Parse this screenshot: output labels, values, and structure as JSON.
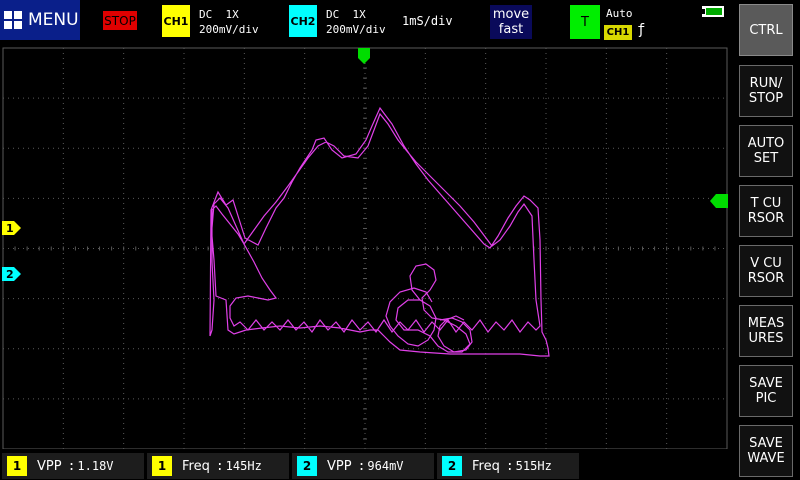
{
  "topbar": {
    "menu_label": "MENU",
    "stop_label": "STOP",
    "ch1": {
      "badge": "CH1",
      "coupling": "DC  1X",
      "scale": "200mV/div",
      "color": "#ffff00"
    },
    "ch2": {
      "badge": "CH2",
      "coupling": "DC  1X",
      "scale": "200mV/div",
      "color": "#00ffff"
    },
    "timebase": "1mS/div",
    "move_line1": "move",
    "move_line2": "fast",
    "trigger": {
      "badge": "T",
      "mode": "Auto",
      "source": "CH1",
      "edge": "ƒ",
      "color": "#00ee00"
    }
  },
  "markers": {
    "ch1_label": "1",
    "ch2_label": "2"
  },
  "side_buttons": [
    {
      "label": "CTRL",
      "active": true
    },
    {
      "label": "RUN/\nSTOP",
      "active": false
    },
    {
      "label": "AUTO\nSET",
      "active": false
    },
    {
      "label": "T CU\nRSOR",
      "active": false
    },
    {
      "label": "V CU\nRSOR",
      "active": false
    },
    {
      "label": "MEAS\nURES",
      "active": false
    },
    {
      "label": "SAVE\nPIC",
      "active": false
    },
    {
      "label": "SAVE\nWAVE",
      "active": false
    }
  ],
  "measurements": [
    {
      "channel": "1",
      "label": "VPP",
      "value": "1.18V",
      "color": "#ffff00"
    },
    {
      "channel": "1",
      "label": "Freq",
      "value": "145Hz",
      "color": "#ffff00"
    },
    {
      "channel": "2",
      "label": "VPP",
      "value": "964mV",
      "color": "#00ffff"
    },
    {
      "channel": "2",
      "label": "Freq",
      "value": "515Hz",
      "color": "#00ffff"
    }
  ],
  "colors": {
    "trace": "#e040e8",
    "grid": "#5a5a5a",
    "menu_bg": "#0a1f8a",
    "stop_bg": "#e00000"
  }
}
